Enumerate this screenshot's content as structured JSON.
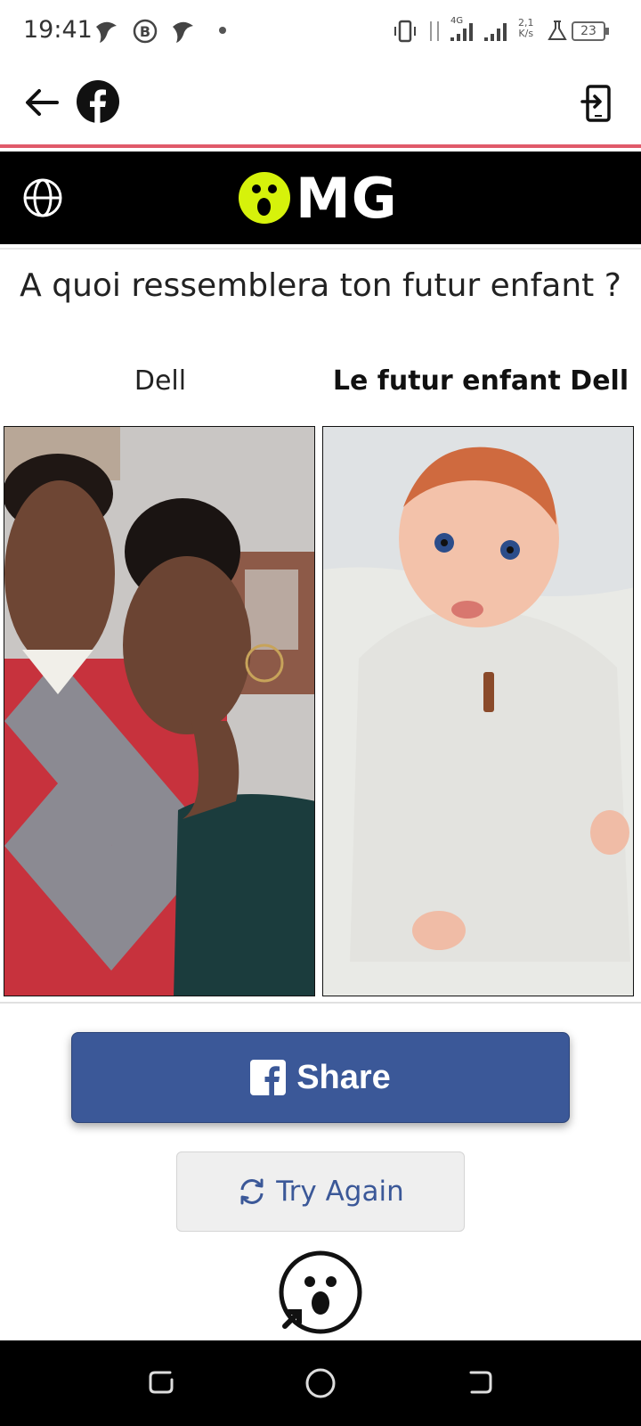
{
  "status_bar": {
    "time": "19:41",
    "net_speed": "2,1",
    "net_unit": "K/s",
    "battery": "23",
    "network_type": "4G"
  },
  "app_bar": {
    "back_icon": "arrow-left-icon",
    "app_icon": "facebook-icon",
    "exit_icon": "exit-to-app-icon"
  },
  "header": {
    "logo_text": "MG",
    "globe_icon": "globe-icon"
  },
  "question": "A quoi ressemblera ton futur enfant ?",
  "labels": {
    "left": "Dell",
    "right": "Le futur enfant Dell"
  },
  "buttons": {
    "share": "Share",
    "try_again": "Try Again"
  },
  "colors": {
    "accent_blue": "#3b5898",
    "logo_yellow": "#d6f20b",
    "load_bar": "#e05a6a"
  }
}
